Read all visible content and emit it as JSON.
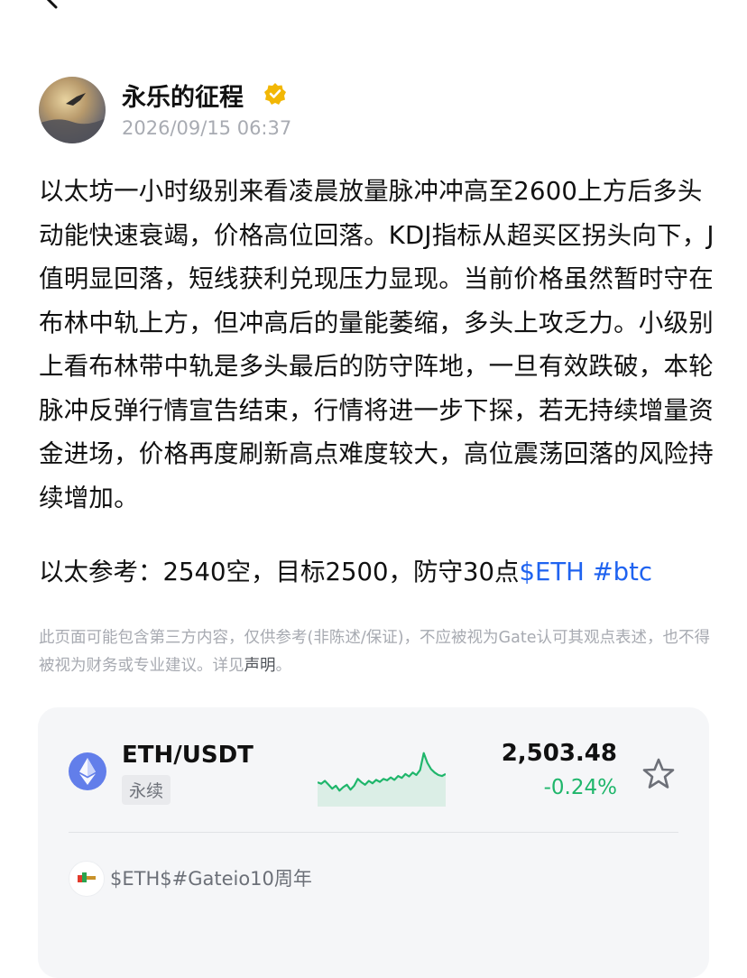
{
  "author": {
    "name": "永乐的征程",
    "time": "2026/09/15 06:37"
  },
  "post": {
    "body": "以太坊一小时级别来看凌晨放量脉冲冲高至2600上方后多头动能快速衰竭，价格高位回落。KDJ指标从超买区拐头向下，J值明显回落，短线获利兑现压力显现。当前价格虽然暂时守在布林中轨上方，但冲高后的量能萎缩，多头上攻乏力。小级别上看布林带中轨是多头最后的防守阵地，一旦有效跌破，本轮脉冲反弹行情宣告结束，行情将进一步下探，若无持续增量资金进场，价格再度刷新高点难度较大，高位震荡回落的风险持续增加。",
    "reference": "以太参考：2540空，目标2500，防守30点",
    "tags": [
      "$ETH",
      "#btc"
    ]
  },
  "disclaimer": {
    "text": "此页面可能包含第三方内容，仅供参考(非陈述/保证)，不应被视为Gate认可其观点表述，也不得被视为财务或专业建议。详见",
    "link": "声明",
    "end": "。"
  },
  "ticker": {
    "pair": "ETH/USDT",
    "type": "永续",
    "price": "2,503.48",
    "change": "-0.24%",
    "change_color": "#1fb66b",
    "sparkline": [
      0.35,
      0.32,
      0.38,
      0.3,
      0.22,
      0.28,
      0.18,
      0.25,
      0.3,
      0.2,
      0.28,
      0.42,
      0.35,
      0.3,
      0.38,
      0.33,
      0.4,
      0.36,
      0.42,
      0.39,
      0.45,
      0.4,
      0.48,
      0.44,
      0.52,
      0.47,
      0.55,
      0.5,
      0.6,
      0.95,
      0.75,
      0.62,
      0.55,
      0.5,
      0.48,
      0.52
    ]
  },
  "source": {
    "text": "$ETH$#Gateio10周年"
  },
  "colors": {
    "accent": "#1f63f0",
    "verified": "#f2b705",
    "eth_icon": "#627eea"
  },
  "icons": [
    "back-arrow-icon",
    "verified-badge-icon",
    "eth-coin-icon",
    "star-icon"
  ]
}
